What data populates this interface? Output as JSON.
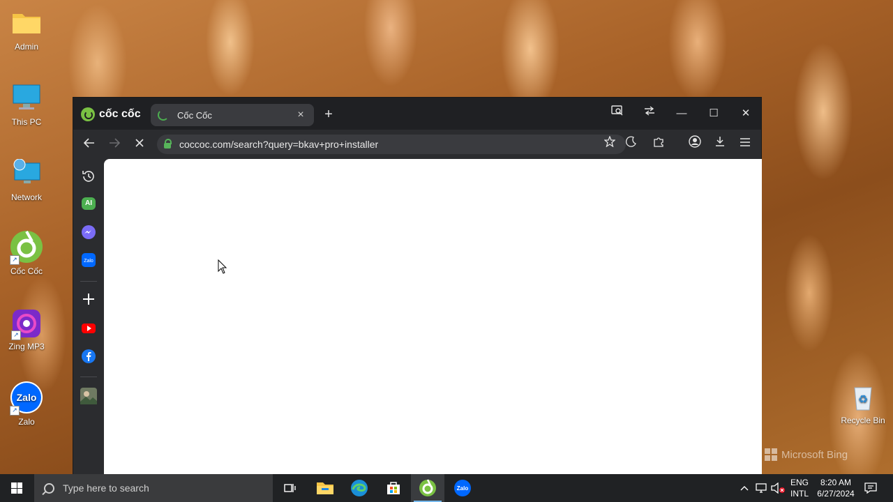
{
  "desktop": {
    "icons": [
      {
        "label": "Admin",
        "icon": "folder-icon"
      },
      {
        "label": "This PC",
        "icon": "computer-icon"
      },
      {
        "label": "Network",
        "icon": "network-icon"
      },
      {
        "label": "Cốc Cốc",
        "icon": "coccoc-icon"
      },
      {
        "label": "Zing MP3",
        "icon": "zing-mp3-icon"
      },
      {
        "label": "Zalo",
        "icon": "zalo-icon"
      },
      {
        "label": "Recycle Bin",
        "icon": "recycle-bin-icon"
      }
    ],
    "watermark": "Microsoft Bing"
  },
  "browser": {
    "brand": "cốc cốc",
    "tab": {
      "title": "Cốc Cốc",
      "close": "×"
    },
    "new_tab": "+",
    "window_controls": {
      "minimize": "—",
      "maximize": "☐",
      "close": "✕"
    },
    "address": "coccoc.com/search?query=bkav+pro+installer",
    "sidebar_ai_label": "AI",
    "sidebar_zalo_label": "Zalo",
    "colors": {
      "accent": "#7ac143",
      "frame": "#2b2c2f",
      "titlebar": "#1f2023"
    }
  },
  "taskbar": {
    "search_placeholder": "Type here to search",
    "lang_primary": "ENG",
    "lang_secondary": "INTL",
    "time": "8:20 AM",
    "date": "6/27/2024"
  }
}
